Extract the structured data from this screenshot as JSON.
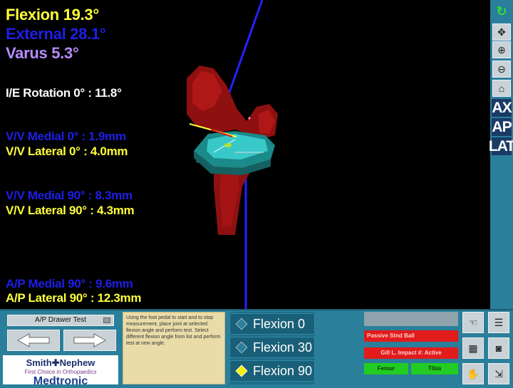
{
  "readouts": {
    "flexion": "Flexion 19.3°",
    "external": "External 28.1°",
    "varus": "Varus 5.3°",
    "ie_rotation": "I/E Rotation 0° : 11.8°",
    "vv_medial_0": "V/V Medial 0°   : 1.9mm",
    "vv_lateral_0": "V/V Lateral 0°  : 4.0mm",
    "vv_medial_90": "V/V Medial 90°  : 8.3mm",
    "vv_lateral_90": "V/V Lateral 90° : 4.3mm",
    "ap_medial_90": "A/P Medial 90°  : 9.6mm",
    "ap_lateral_90": "A/P Lateral 90° : 12.3mm"
  },
  "colors": {
    "flexion": "#ffff3a",
    "external": "#1e1ee6",
    "varus": "#b58cff",
    "white": "#ffffff",
    "medial": "#1e1ee6",
    "lateral": "#ffff3a",
    "panel_bg": "#2a7f9b",
    "status_red": "#e21b1b",
    "status_green": "#22cc22"
  },
  "toolbar": {
    "refresh_icon": "refresh-icon",
    "pan_icon": "pan-icon",
    "zoom_in_icon": "zoom-in-icon",
    "zoom_out_icon": "zoom-out-icon",
    "home_icon": "home-icon",
    "ax_label": "AX",
    "ap_label": "AP",
    "lat_label": "LAT"
  },
  "test_select": {
    "value": "A/P Drawer Test"
  },
  "logo": {
    "line1": "Smith✚Nephew",
    "line2": "First Choice in Orthopaedics",
    "line3": "Medtronic"
  },
  "instructions": "Using the foot pedal to start and to stop measurement, place joint at selected flexion angle and perform test. Select different flexion angle from list and perform test at new angle.",
  "flexion_options": [
    {
      "label": "Flexion 0",
      "selected": false
    },
    {
      "label": "Flexion 30",
      "selected": false
    },
    {
      "label": "Flexion 90",
      "selected": true
    }
  ],
  "status": {
    "passive_label": "Passive Stnd Ball",
    "impact_label": "Gill L. Impact #: Active",
    "femur_label": "Femur",
    "tibia_label": "Tibia"
  }
}
